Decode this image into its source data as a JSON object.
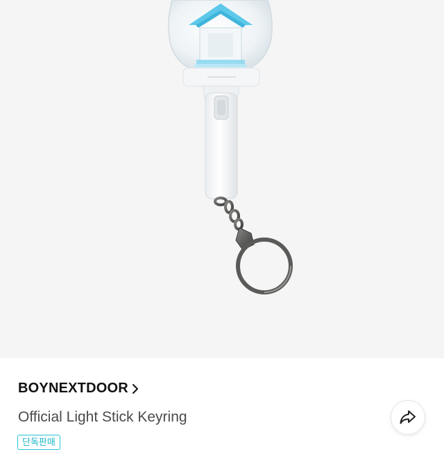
{
  "product": {
    "brand": "BOYNEXTDOOR",
    "title": "Official Light Stick Keyring",
    "badge": "단독판매",
    "image_description_icon": "light-stick-keyring-image"
  },
  "actions": {
    "brand_link_icon": "chevron-right-icon",
    "share_icon": "share-arrow-icon"
  },
  "colors": {
    "accent": "#1bb7c9",
    "photo_bg": "#f5f5f5",
    "light_blue": "#5cc8ea"
  }
}
